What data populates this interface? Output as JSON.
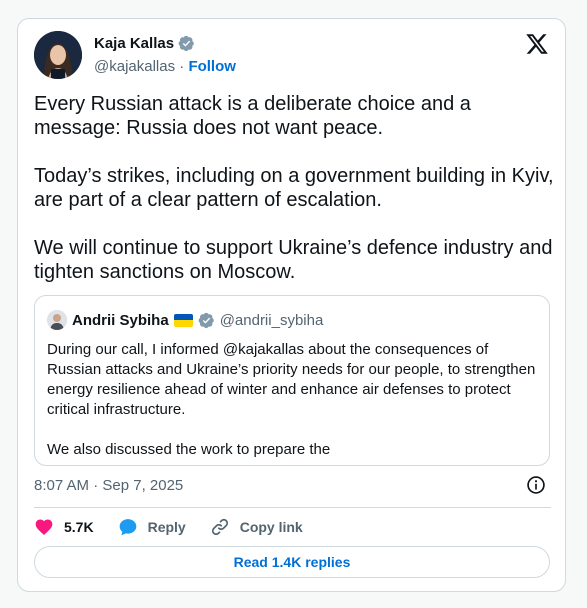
{
  "author": {
    "name": "Kaja Kallas",
    "handle": "@kajakallas",
    "separator": " · ",
    "follow_label": "Follow"
  },
  "tweet": {
    "text": "Every Russian attack is a deliberate choice and a message: Russia does not want peace.\n\nToday’s strikes, including on a government building in Kyiv, are part of a clear pattern of escalation.\n\nWe will continue to support Ukraine’s defence industry and tighten sanctions on Moscow.",
    "timestamp": "8:07 AM · Sep 7, 2025"
  },
  "quote": {
    "name": "Andrii Sybiha",
    "handle": "@andrii_sybiha",
    "text": "During our call, I informed @kajakallas about the consequences of Russian attacks and Ukraine’s priority needs for our people, to strengthen energy resilience ahead of winter and enhance air defenses to protect critical infrastructure.\n\nWe also discussed the work to prepare the"
  },
  "actions": {
    "like_count": "5.7K",
    "reply_label": "Reply",
    "copy_link_label": "Copy link"
  },
  "read_replies_label": "Read 1.4K replies",
  "colors": {
    "accent": "#006fd6",
    "verified": "#829aab",
    "like": "#f91880",
    "reply": "#1d9bf0",
    "secondary_text": "#536471",
    "border": "#cfd9de"
  },
  "icons": {
    "verified": "verified-badge-icon",
    "x_logo": "x-logo-icon",
    "info": "info-icon",
    "like": "heart-icon",
    "reply": "speech-bubble-icon",
    "copy_link": "link-icon"
  }
}
